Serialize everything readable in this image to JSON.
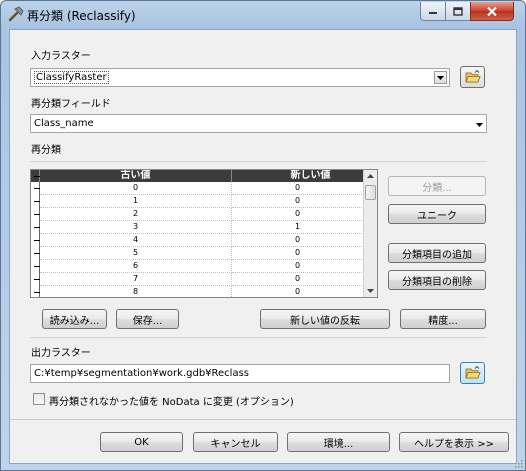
{
  "window": {
    "title": "再分類 (Reclassify)",
    "icon": "hammer-icon"
  },
  "input_raster": {
    "label": "入力ラスター",
    "value": "ClassifyRaster"
  },
  "reclass_field": {
    "label": "再分類フィールド",
    "value": "Class_name"
  },
  "reclass_section": {
    "label": "再分類"
  },
  "table": {
    "columns": [
      "古い値",
      "新しい値"
    ],
    "rows": [
      {
        "old": "0",
        "new": "0"
      },
      {
        "old": "1",
        "new": "0"
      },
      {
        "old": "2",
        "new": "0"
      },
      {
        "old": "3",
        "new": "1"
      },
      {
        "old": "4",
        "new": "0"
      },
      {
        "old": "5",
        "new": "0"
      },
      {
        "old": "6",
        "new": "0"
      },
      {
        "old": "7",
        "new": "0"
      },
      {
        "old": "8",
        "new": "0"
      }
    ]
  },
  "side_buttons": {
    "classify": "分類...",
    "unique": "ユニーク",
    "add_entry": "分類項目の追加",
    "delete_entry": "分類項目の削除"
  },
  "table_buttons": {
    "load": "読み込み...",
    "save": "保存...",
    "reverse": "新しい値の反転",
    "precision": "精度..."
  },
  "output_raster": {
    "label": "出力ラスター",
    "value": "C:¥temp¥segmentation¥work.gdb¥Reclass"
  },
  "nodata_option": {
    "label": "再分類されなかった値を NoData に変更 (オプション)",
    "checked": false
  },
  "footer": {
    "ok": "OK",
    "cancel": "キャンセル",
    "environments": "環境...",
    "show_help": "ヘルプを表示 >>"
  },
  "colors": {
    "title_bar": "#b8cfe8",
    "dialog_bg": "#f0f0f0",
    "grid_header": "#3c3c3c",
    "close_button": "#c7402a"
  }
}
